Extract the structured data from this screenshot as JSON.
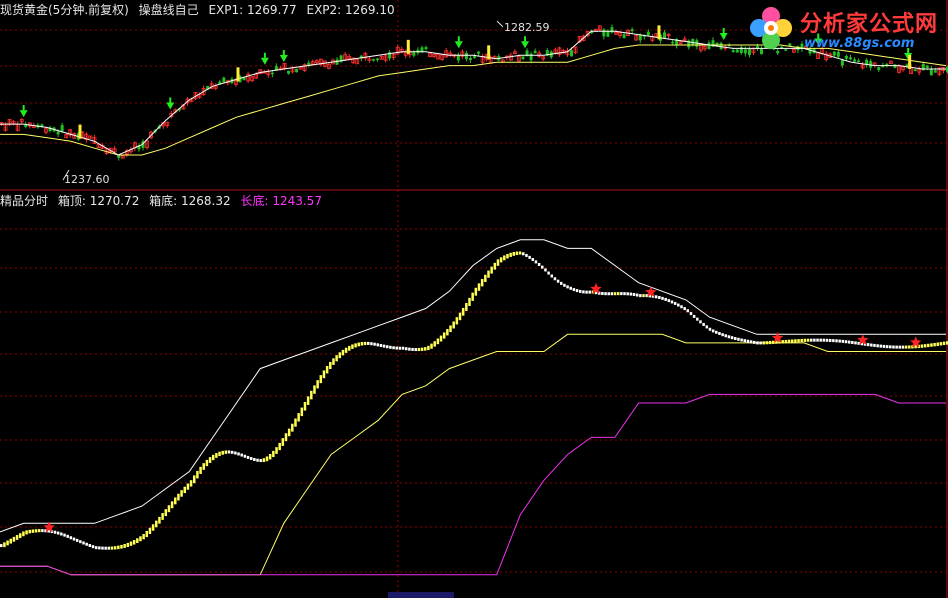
{
  "header_top": {
    "title": "现货黄金(5分钟.前复权)",
    "indicator": "操盘线自己",
    "exp1": "EXP1: 1269.77",
    "exp2": "EXP2: 1269.10"
  },
  "header_bottom": {
    "title": "精品分时",
    "box_top": "箱顶: 1270.72",
    "box_bottom": "箱底: 1268.32",
    "long_bottom": "长底: 1243.57"
  },
  "logo": {
    "name": "分析家公式网",
    "url": "www.88gs.com"
  },
  "colors": {
    "up": "#ff3030",
    "down": "#22c022",
    "white_line": "#ffffff",
    "yellow_line": "#ffff66",
    "magenta_line": "#ee33ee",
    "grid": "#8b0000",
    "arrow": "#22ee22",
    "star": "#ff2222"
  },
  "chart_data": [
    {
      "type": "line",
      "panel": "top",
      "annotations": [
        {
          "text": "1282.59",
          "kind": "high"
        },
        {
          "text": "1237.60",
          "kind": "low"
        }
      ],
      "series": [
        {
          "name": "EXP1",
          "values": [
            1253,
            1253,
            1252,
            1250,
            1248,
            1244,
            1247,
            1254,
            1260,
            1264,
            1266,
            1268,
            1269,
            1270,
            1271,
            1272,
            1273,
            1274,
            1274,
            1273,
            1273,
            1272,
            1273,
            1273,
            1274,
            1280,
            1280,
            1279,
            1278,
            1277,
            1276,
            1275,
            1275,
            1275,
            1275,
            1273,
            1271,
            1270,
            1270,
            1269,
            1269
          ]
        },
        {
          "name": "EXP2",
          "values": [
            1250,
            1250,
            1249,
            1248,
            1246,
            1244,
            1244,
            1246,
            1249,
            1252,
            1255,
            1257,
            1259,
            1261,
            1263,
            1265,
            1267,
            1268,
            1269,
            1270,
            1270,
            1271,
            1271,
            1271,
            1271,
            1273,
            1275,
            1276,
            1276,
            1276,
            1276,
            1276,
            1276,
            1276,
            1275,
            1275,
            1274,
            1273,
            1272,
            1271,
            1270
          ]
        }
      ],
      "ylim": [
        1235,
        1285
      ],
      "grid": true
    },
    {
      "type": "line",
      "panel": "bottom",
      "series": [
        {
          "name": "箱顶",
          "values": [
            1247,
            1248,
            1248,
            1248,
            1248,
            1249,
            1250,
            1252,
            1254,
            1258,
            1262,
            1266,
            1267,
            1268,
            1269,
            1270,
            1271,
            1272,
            1273,
            1275,
            1278,
            1280,
            1281,
            1281,
            1280,
            1280,
            1278,
            1276,
            1275,
            1274,
            1272,
            1271,
            1270,
            1270,
            1270,
            1270,
            1270,
            1270,
            1270,
            1270,
            1270
          ]
        },
        {
          "name": "箱底",
          "values": [
            1243,
            1243,
            1243,
            1242,
            1242,
            1242,
            1242,
            1242,
            1242,
            1242,
            1242,
            1242,
            1248,
            1252,
            1256,
            1258,
            1260,
            1263,
            1264,
            1266,
            1267,
            1268,
            1268,
            1268,
            1270,
            1270,
            1270,
            1270,
            1270,
            1269,
            1269,
            1269,
            1269,
            1269,
            1269,
            1268,
            1268,
            1268,
            1268,
            1268,
            1268
          ]
        },
        {
          "name": "长底",
          "values": [
            1243,
            1243,
            1243,
            1242,
            1242,
            1242,
            1242,
            1242,
            1242,
            1242,
            1242,
            1242,
            1242,
            1242,
            1242,
            1242,
            1242,
            1242,
            1242,
            1242,
            1242,
            1242,
            1249,
            1253,
            1256,
            1258,
            1258,
            1262,
            1262,
            1262,
            1263,
            1263,
            1263,
            1263,
            1263,
            1263,
            1263,
            1263,
            1262,
            1262,
            1262
          ]
        }
      ],
      "ylim": [
        1240,
        1284
      ],
      "grid": true
    }
  ]
}
